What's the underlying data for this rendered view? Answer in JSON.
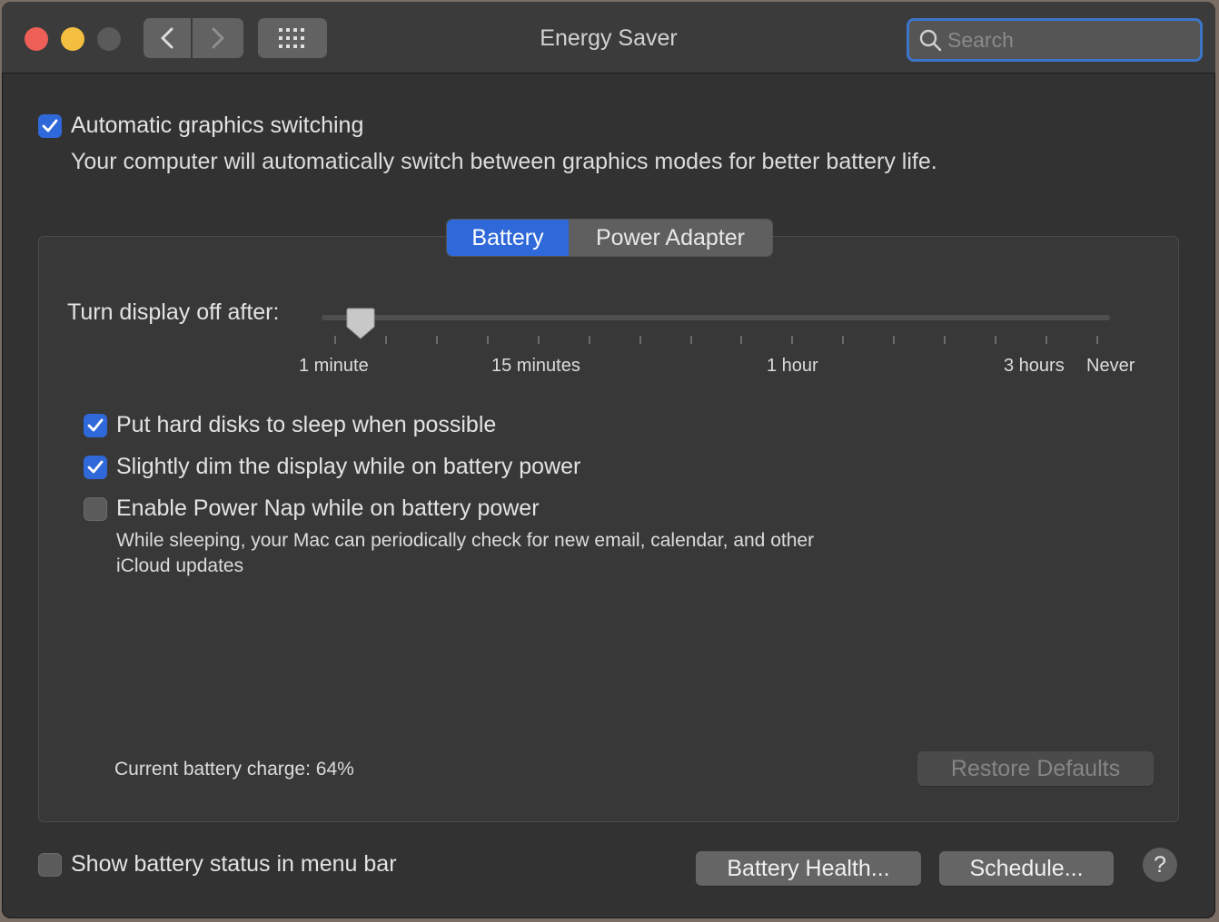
{
  "window": {
    "title": "Energy Saver"
  },
  "search": {
    "placeholder": "Search"
  },
  "graphics": {
    "checked": true,
    "label": "Automatic graphics switching",
    "description": "Your computer will automatically switch between graphics modes for better battery life."
  },
  "tabs": [
    {
      "label": "Battery",
      "active": true
    },
    {
      "label": "Power Adapter",
      "active": false
    }
  ],
  "display_slider": {
    "label": "Turn display off after:",
    "ticks": [
      "1 minute",
      "15 minutes",
      "1 hour",
      "3 hours",
      "Never"
    ],
    "tick_count": 16,
    "value": "2 minutes"
  },
  "options": [
    {
      "label": "Put hard disks to sleep when possible",
      "checked": true
    },
    {
      "label": "Slightly dim the display while on battery power",
      "checked": true
    },
    {
      "label": "Enable Power Nap while on battery power",
      "checked": false
    }
  ],
  "power_nap_description": {
    "line1": "While sleeping, your Mac can periodically check for new email, calendar, and other",
    "line2": "iCloud updates"
  },
  "battery": {
    "charge_text": "Current battery charge: 64%"
  },
  "buttons": {
    "restore_defaults": "Restore Defaults",
    "battery_health": "Battery Health...",
    "schedule": "Schedule...",
    "help": "?"
  },
  "menu_bar_status": {
    "label": "Show battery status in menu bar",
    "checked": false
  },
  "colors": {
    "accent": "#2f68d8",
    "close": "#ed5f57",
    "minimize": "#f4be41"
  },
  "icons": [
    "chevron-left-icon",
    "chevron-right-icon",
    "grid-icon",
    "search-icon",
    "checkmark-icon"
  ]
}
